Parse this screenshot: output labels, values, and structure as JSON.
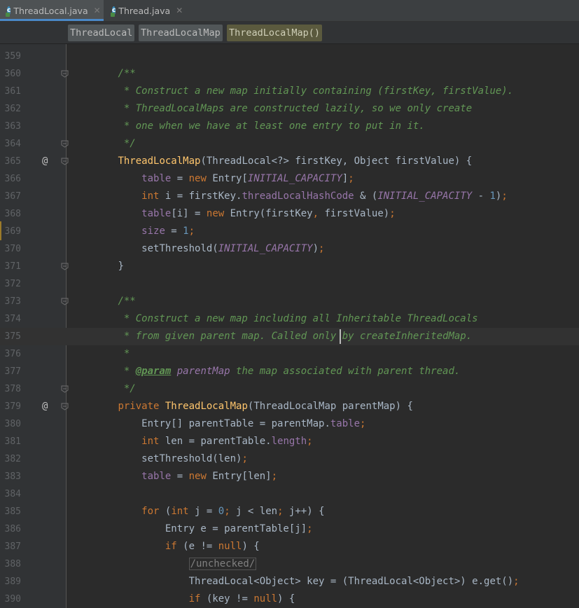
{
  "tabs": [
    {
      "label": "ThreadLocal.java",
      "active": true
    },
    {
      "label": "Thread.java",
      "active": false
    }
  ],
  "breadcrumbs": [
    {
      "label": "ThreadLocal",
      "highlight": false
    },
    {
      "label": "ThreadLocalMap",
      "highlight": false
    },
    {
      "label": "ThreadLocalMap()",
      "highlight": true
    }
  ],
  "lines": [
    {
      "n": "359",
      "tokens": []
    },
    {
      "n": "360",
      "fold": true,
      "tokens": [
        {
          "t": "        "
        },
        {
          "t": "/**",
          "c": "cmt"
        }
      ]
    },
    {
      "n": "361",
      "tokens": [
        {
          "t": "         "
        },
        {
          "t": "* Construct a new map initially containing (firstKey, firstValue).",
          "c": "cmt"
        }
      ]
    },
    {
      "n": "362",
      "tokens": [
        {
          "t": "         "
        },
        {
          "t": "* ThreadLocalMaps are constructed lazily, so we only create",
          "c": "cmt"
        }
      ]
    },
    {
      "n": "363",
      "tokens": [
        {
          "t": "         "
        },
        {
          "t": "* one when we have at least one entry to put in it.",
          "c": "cmt"
        }
      ]
    },
    {
      "n": "364",
      "fold": true,
      "tokens": [
        {
          "t": "         "
        },
        {
          "t": "*/",
          "c": "cmt"
        }
      ]
    },
    {
      "n": "365",
      "at": true,
      "fold": true,
      "tokens": [
        {
          "t": "        "
        },
        {
          "t": "ThreadLocalMap",
          "c": "fn"
        },
        {
          "t": "(ThreadLocal<?> firstKey, Object firstValue) {"
        }
      ]
    },
    {
      "n": "366",
      "tokens": [
        {
          "t": "            "
        },
        {
          "t": "table",
          "c": "fld"
        },
        {
          "t": " = "
        },
        {
          "t": "new ",
          "c": "kw"
        },
        {
          "t": "Entry["
        },
        {
          "t": "INITIAL_CAPACITY",
          "c": "cnst"
        },
        {
          "t": "]"
        },
        {
          "t": ";",
          "c": "kw"
        }
      ]
    },
    {
      "n": "367",
      "tokens": [
        {
          "t": "            "
        },
        {
          "t": "int ",
          "c": "kw"
        },
        {
          "t": "i = firstKey."
        },
        {
          "t": "threadLocalHashCode",
          "c": "fld"
        },
        {
          "t": " & ("
        },
        {
          "t": "INITIAL_CAPACITY",
          "c": "cnst"
        },
        {
          "t": " - "
        },
        {
          "t": "1",
          "c": "num"
        },
        {
          "t": ")"
        },
        {
          "t": ";",
          "c": "kw"
        }
      ]
    },
    {
      "n": "368",
      "tokens": [
        {
          "t": "            "
        },
        {
          "t": "table",
          "c": "fld"
        },
        {
          "t": "[i] = "
        },
        {
          "t": "new ",
          "c": "kw"
        },
        {
          "t": "Entry(firstKey"
        },
        {
          "t": ", ",
          "c": "kw"
        },
        {
          "t": "firstValue)"
        },
        {
          "t": ";",
          "c": "kw"
        }
      ]
    },
    {
      "n": "369",
      "tokens": [
        {
          "t": "            "
        },
        {
          "t": "size",
          "c": "fld"
        },
        {
          "t": " = "
        },
        {
          "t": "1",
          "c": "num"
        },
        {
          "t": ";",
          "c": "kw"
        }
      ]
    },
    {
      "n": "370",
      "tokens": [
        {
          "t": "            "
        },
        {
          "t": "setThreshold("
        },
        {
          "t": "INITIAL_CAPACITY",
          "c": "cnst"
        },
        {
          "t": ")"
        },
        {
          "t": ";",
          "c": "kw"
        }
      ]
    },
    {
      "n": "371",
      "fold": true,
      "tokens": [
        {
          "t": "        "
        },
        {
          "t": "}"
        }
      ]
    },
    {
      "n": "372",
      "tokens": []
    },
    {
      "n": "373",
      "fold": true,
      "tokens": [
        {
          "t": "        "
        },
        {
          "t": "/**",
          "c": "cmt"
        }
      ]
    },
    {
      "n": "374",
      "tokens": [
        {
          "t": "         "
        },
        {
          "t": "* Construct a new map including all Inheritable ThreadLocals",
          "c": "cmt"
        }
      ]
    },
    {
      "n": "375",
      "caret": true,
      "tokens": [
        {
          "t": "         "
        },
        {
          "t": "* from given parent map. Called only by createInheritedMap.",
          "c": "cmt"
        }
      ]
    },
    {
      "n": "376",
      "tokens": [
        {
          "t": "         "
        },
        {
          "t": "*",
          "c": "cmt"
        }
      ]
    },
    {
      "n": "377",
      "tokens": [
        {
          "t": "         "
        },
        {
          "t": "* ",
          "c": "cmt"
        },
        {
          "t": "@param",
          "c": "tag"
        },
        {
          "t": " parentMap",
          "c": "cnst"
        },
        {
          "t": " the map associated with parent thread.",
          "c": "cmt"
        }
      ]
    },
    {
      "n": "378",
      "fold": true,
      "tokens": [
        {
          "t": "         "
        },
        {
          "t": "*/",
          "c": "cmt"
        }
      ]
    },
    {
      "n": "379",
      "at": true,
      "fold": true,
      "tokens": [
        {
          "t": "        "
        },
        {
          "t": "private ",
          "c": "kw"
        },
        {
          "t": "ThreadLocalMap",
          "c": "fn"
        },
        {
          "t": "(ThreadLocalMap parentMap) {"
        }
      ]
    },
    {
      "n": "380",
      "tokens": [
        {
          "t": "            "
        },
        {
          "t": "Entry[] parentTable = parentMap."
        },
        {
          "t": "table",
          "c": "fld"
        },
        {
          "t": ";",
          "c": "kw"
        }
      ]
    },
    {
      "n": "381",
      "tokens": [
        {
          "t": "            "
        },
        {
          "t": "int ",
          "c": "kw"
        },
        {
          "t": "len = parentTable."
        },
        {
          "t": "length",
          "c": "fld"
        },
        {
          "t": ";",
          "c": "kw"
        }
      ]
    },
    {
      "n": "382",
      "tokens": [
        {
          "t": "            "
        },
        {
          "t": "setThreshold(len)"
        },
        {
          "t": ";",
          "c": "kw"
        }
      ]
    },
    {
      "n": "383",
      "tokens": [
        {
          "t": "            "
        },
        {
          "t": "table",
          "c": "fld"
        },
        {
          "t": " = "
        },
        {
          "t": "new ",
          "c": "kw"
        },
        {
          "t": "Entry[len]"
        },
        {
          "t": ";",
          "c": "kw"
        }
      ]
    },
    {
      "n": "384",
      "tokens": []
    },
    {
      "n": "385",
      "tokens": [
        {
          "t": "            "
        },
        {
          "t": "for ",
          "c": "kw"
        },
        {
          "t": "("
        },
        {
          "t": "int ",
          "c": "kw"
        },
        {
          "t": "j = "
        },
        {
          "t": "0",
          "c": "num"
        },
        {
          "t": "; ",
          "c": "kw"
        },
        {
          "t": "j < len"
        },
        {
          "t": "; ",
          "c": "kw"
        },
        {
          "t": "j++) {"
        }
      ]
    },
    {
      "n": "386",
      "tokens": [
        {
          "t": "                "
        },
        {
          "t": "Entry e = parentTable[j]"
        },
        {
          "t": ";",
          "c": "kw"
        }
      ]
    },
    {
      "n": "387",
      "tokens": [
        {
          "t": "                "
        },
        {
          "t": "if ",
          "c": "kw"
        },
        {
          "t": "(e != "
        },
        {
          "t": "null",
          "c": "kw"
        },
        {
          "t": ") {"
        }
      ]
    },
    {
      "n": "388",
      "tokens": [
        {
          "t": "                    "
        },
        {
          "t": "/unchecked/",
          "c": "boxed"
        }
      ]
    },
    {
      "n": "389",
      "tokens": [
        {
          "t": "                    "
        },
        {
          "t": "ThreadLocal<Object> key = (ThreadLocal<Object>) e.get()"
        },
        {
          "t": ";",
          "c": "kw"
        }
      ]
    },
    {
      "n": "390",
      "tokens": [
        {
          "t": "                    "
        },
        {
          "t": "if ",
          "c": "kw"
        },
        {
          "t": "(key != "
        },
        {
          "t": "null",
          "c": "kw"
        },
        {
          "t": ") {"
        }
      ]
    }
  ]
}
